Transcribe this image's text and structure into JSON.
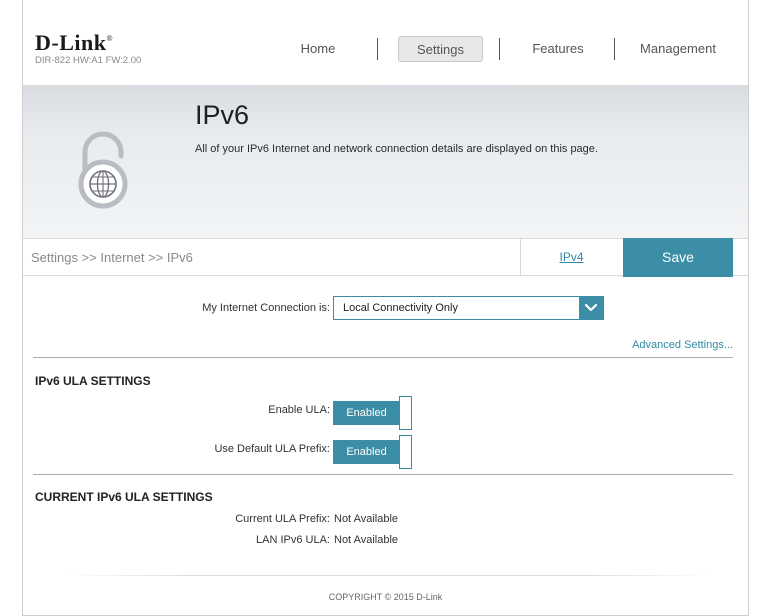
{
  "header": {
    "brand": "D-Link",
    "trademark": "®",
    "hw_info": "DIR-822 HW:A1 FW:2.00",
    "nav": [
      {
        "label": "Home"
      },
      {
        "label": "Settings",
        "active": true
      },
      {
        "label": "Features"
      },
      {
        "label": "Management"
      }
    ]
  },
  "banner": {
    "title": "IPv6",
    "description": "All of your IPv6 Internet and network connection details are displayed on this page.",
    "icon": "lock-globe-icon"
  },
  "breadcrumb": {
    "path": "Settings >> Internet >> IPv6",
    "ipv4_link": "IPv4",
    "save_label": "Save"
  },
  "connection": {
    "label": "My Internet Connection is:",
    "value": "Local Connectivity Only",
    "advanced_link": "Advanced Settings..."
  },
  "ula_settings": {
    "title": "IPv6 ULA SETTINGS",
    "enable_ula_label": "Enable ULA:",
    "enable_ula_value": "Enabled",
    "default_prefix_label": "Use Default ULA Prefix:",
    "default_prefix_value": "Enabled"
  },
  "current_ula": {
    "title": "CURRENT IPv6 ULA SETTINGS",
    "prefix_label": "Current ULA Prefix:",
    "prefix_value": "Not Available",
    "lan_label": "LAN IPv6 ULA:",
    "lan_value": "Not Available"
  },
  "footer": {
    "copyright": "COPYRIGHT © 2015 D-Link"
  },
  "colors": {
    "accent": "#3b8ea5",
    "link": "#3189a8",
    "banner_bg": "#e9ecef"
  }
}
